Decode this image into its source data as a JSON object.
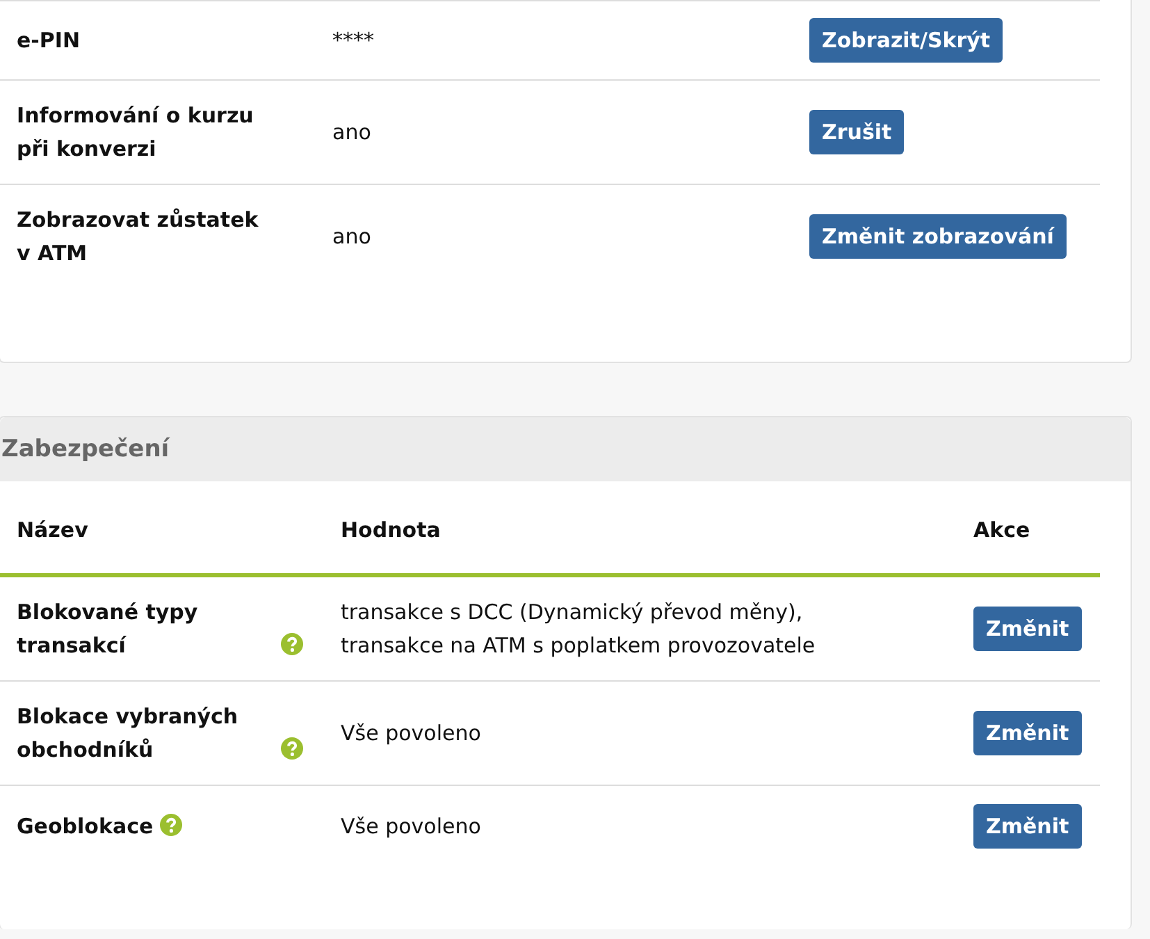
{
  "card_settings": {
    "rows": [
      {
        "name": "e-PIN",
        "value": "****",
        "action": "Zobrazit/Skrýt"
      },
      {
        "name": "Informování o kurzu při konverzi",
        "value": "ano",
        "action": "Zrušit"
      },
      {
        "name": "Zobrazovat zůstatek v ATM",
        "value": "ano",
        "action": "Změnit zobrazování"
      }
    ]
  },
  "security": {
    "title": "Zabezpečení",
    "columns": [
      "Název",
      "Hodnota",
      "Akce"
    ],
    "rows": [
      {
        "name": "Blokované typy transakcí",
        "help": true,
        "value": "transakce s DCC (Dynamický převod měny), transakce na ATM s poplatkem provozovatele",
        "action": "Změnit"
      },
      {
        "name": "Blokace vybraných obchodníků",
        "help": true,
        "value": "Vše povoleno",
        "action": "Změnit"
      },
      {
        "name": "Geoblokace",
        "help": true,
        "value": "Vše povoleno",
        "action": "Změnit"
      }
    ]
  }
}
